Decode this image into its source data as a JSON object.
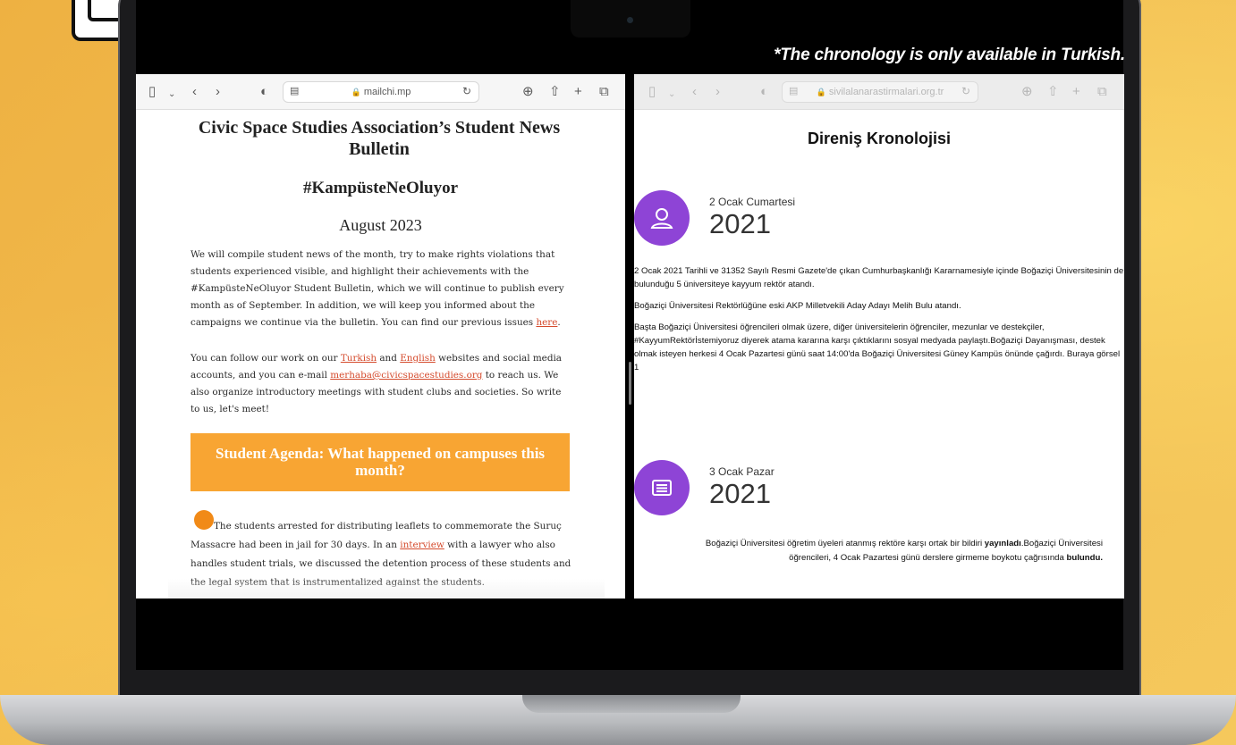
{
  "note": "*The chronology is only available in Turkish.",
  "left_browser": {
    "url": "mailchi.mp",
    "title": "Civic Space Studies Association’s Student News Bulletin",
    "hashtag": "#KampüsteNeOluyor",
    "month": "August 2023",
    "para1": {
      "text": "We will compile student news of the month, try to make rights violations that students experienced visible, and highlight their achievements with the #KampüsteNeOluyor Student Bulletin, which we will continue to publish every month as of September. In addition, we will keep you informed about the campaigns we continue via the bulletin. You can find our previous issues ",
      "link": "here",
      "end": "."
    },
    "para2": {
      "t1": "You can follow our work on our ",
      "link1": "Turkish",
      "t2": " and ",
      "link2": "English",
      "t3": " websites and social media accounts, and you can e-mail ",
      "link3": "merhaba@civicspacestudies.org",
      "t4": " to reach us. We also organize introductory meetings with student clubs and societies. So write to us, let's meet!"
    },
    "agenda": "Student Agenda: What happened on campuses this month?",
    "story": {
      "t1": "The students arrested for distributing leaflets to commemorate the Suruç Massacre had been in jail for 30 days. In an ",
      "link": "interview",
      "t2": " with a lawyer who also handles student trials, we discussed the detention process of these students and the legal system that is instrumentalized against the students."
    }
  },
  "right_browser": {
    "url": "sivilalanarastirmalari.org.tr",
    "title": "Direniş Kronolojisi",
    "entries": [
      {
        "day": "2 Ocak Cumartesi",
        "year": "2021",
        "icon": "person-icon",
        "paragraphs": [
          "2 Ocak 2021 Tarihli ve 31352 Sayılı Resmi Gazete'de çıkan Cumhurbaşkanlığı Kararnamesiyle içinde Boğaziçi Üniversitesinin de bulunduğu 5 üniversiteye kayyum rektör atandı.",
          "Boğaziçi Üniversitesi Rektörlüğüne eski AKP Milletvekili Aday Adayı Melih Bulu atandı.",
          "Başta Boğaziçi Üniversitesi öğrencileri olmak üzere, diğer üniversitelerin öğrenciler, mezunlar ve destekçiler, #KayyumRektörİstemiyoruz diyerek atama kararına karşı çıktıklarını sosyal medyada paylaştı.Boğaziçi Dayanışması, destek olmak isteyen herkesi 4 Ocak Pazartesi günü saat 14:00'da Boğaziçi Üniversitesi Güney Kampüs önünde çağırdı. Buraya görsel 1"
        ]
      },
      {
        "day": "3 Ocak Pazar",
        "year": "2021",
        "icon": "newspaper-icon",
        "text": {
          "t1": "Boğaziçi Üniversitesi öğretim üyeleri atanmış rektöre karşı ortak bir bildiri ",
          "b1": "yayınladı",
          "t2": ".Boğaziçi Üniversitesi öğrencileri, 4 Ocak Pazartesi günü derslere girmeme boykotu çağrısında ",
          "b2": "bulundu."
        }
      }
    ]
  }
}
